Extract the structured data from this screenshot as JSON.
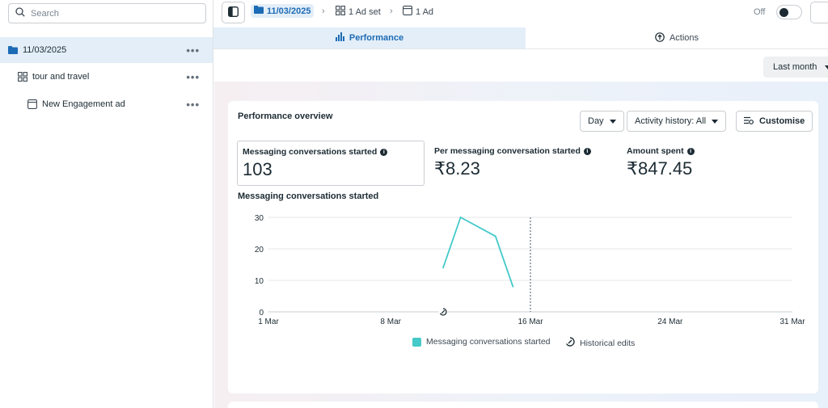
{
  "sidebar": {
    "search_placeholder": "Search",
    "items": [
      {
        "label": "11/03/2025",
        "icon": "folder-icon",
        "selected": true
      },
      {
        "label": "tour and travel",
        "icon": "grid-icon",
        "selected": false
      },
      {
        "label": "New Engagement ad",
        "icon": "ad-icon",
        "selected": false
      }
    ],
    "more": "•••"
  },
  "topbar": {
    "breadcrumbs": [
      {
        "label": "11/03/2025",
        "icon": "folder-icon"
      },
      {
        "label": "1 Ad set",
        "icon": "grid-icon"
      },
      {
        "label": "1 Ad",
        "icon": "ad-icon"
      }
    ],
    "separator": "›",
    "toggle_label": "Off"
  },
  "tabs": [
    {
      "label": "Performance",
      "icon": "bar-chart-icon",
      "active": true
    },
    {
      "label": "Actions",
      "icon": "arrow-up-circle-icon",
      "active": false
    }
  ],
  "period": {
    "selected": "Last month"
  },
  "overview": {
    "title": "Performance overview",
    "granularity": "Day",
    "activity": "Activity history: All",
    "customise": "Customise",
    "metrics": [
      {
        "label": "Messaging conversations started",
        "value": "103"
      },
      {
        "label": "Per messaging conversation started",
        "value": "₹8.23"
      },
      {
        "label": "Amount spent",
        "value": "₹847.45"
      }
    ]
  },
  "chart_data": {
    "type": "line",
    "title": "Messaging conversations started",
    "x_ticks": [
      "1 Mar",
      "8 Mar",
      "16 Mar",
      "24 Mar",
      "31 Mar"
    ],
    "x_tick_days": [
      1,
      8,
      16,
      24,
      31
    ],
    "ylim": [
      0,
      30
    ],
    "y_ticks": [
      0,
      10,
      20,
      30
    ],
    "grid": true,
    "series": [
      {
        "name": "Messaging conversations started",
        "color": "#45c9c9",
        "x": [
          11,
          12,
          14,
          15
        ],
        "y": [
          14,
          30,
          24,
          8
        ]
      }
    ],
    "marker_day": 16,
    "historical_edit_day": 11,
    "legend": [
      "Messaging conversations started",
      "Historical edits"
    ],
    "legend_position": "bottom"
  }
}
